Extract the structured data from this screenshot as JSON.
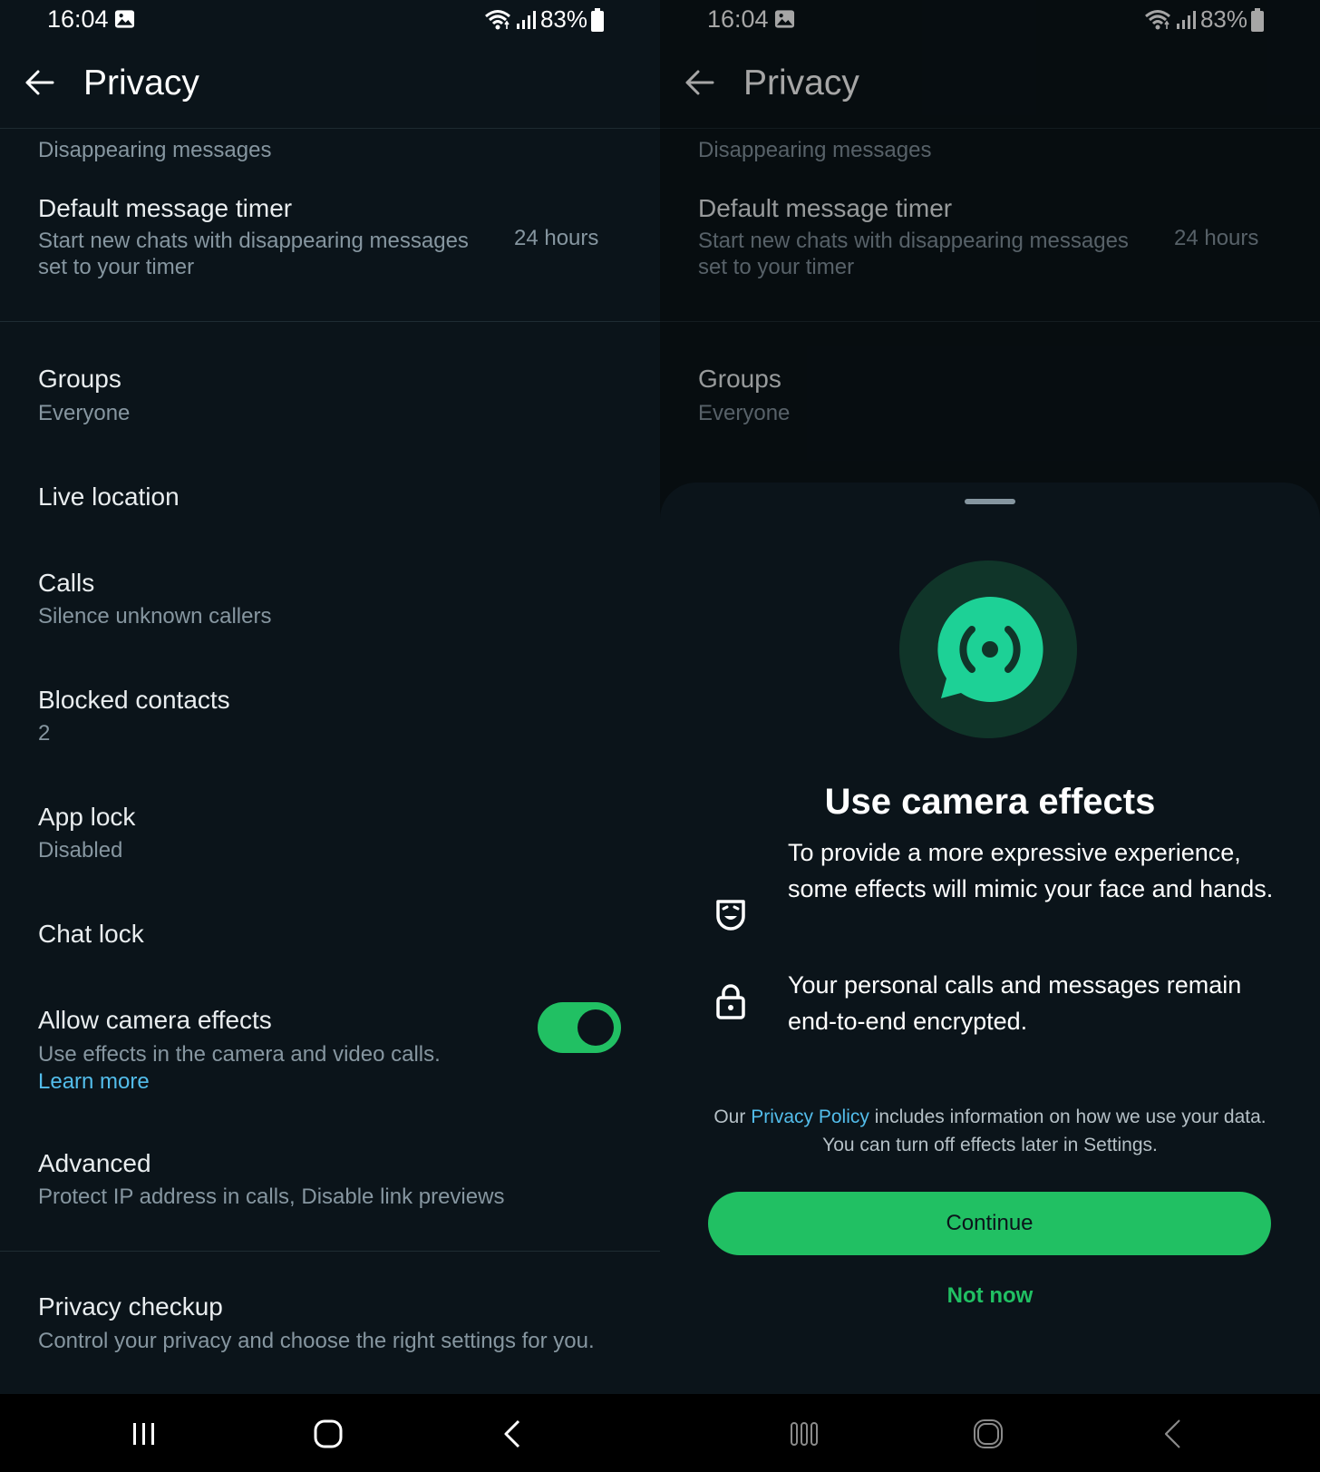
{
  "status_bar": {
    "time": "16:04",
    "battery": "83%"
  },
  "app_bar": {
    "title": "Privacy"
  },
  "privacy": {
    "section_disappearing": "Disappearing messages",
    "default_timer": {
      "title": "Default message timer",
      "subtitle": "Start new chats with disappearing messages set to your timer",
      "value": "24 hours"
    },
    "groups": {
      "title": "Groups",
      "value": "Everyone"
    },
    "live_location": {
      "title": "Live location"
    },
    "calls": {
      "title": "Calls",
      "value": "Silence unknown callers"
    },
    "blocked_contacts": {
      "title": "Blocked contacts",
      "value": "2"
    },
    "app_lock": {
      "title": "App lock",
      "value": "Disabled"
    },
    "chat_lock": {
      "title": "Chat lock"
    },
    "camera_effects": {
      "title": "Allow camera effects",
      "subtitle": "Use effects in the camera and video calls.",
      "link": "Learn more",
      "enabled": true
    },
    "advanced": {
      "title": "Advanced",
      "value": "Protect IP address in calls, Disable link previews"
    },
    "privacy_checkup": {
      "title": "Privacy checkup",
      "value": "Control your privacy and choose the right settings for you."
    }
  },
  "sheet": {
    "title": "Use camera effects",
    "feature_1": "To provide a more expressive experience, some effects will mimic your face and hands.",
    "feature_2": "Your personal calls and messages remain end-to-end encrypted.",
    "policy_prefix": "Our ",
    "policy_link": "Privacy Policy",
    "policy_suffix": " includes information on how we use your data.",
    "policy_line2": "You can turn off effects later in Settings.",
    "continue_label": "Continue",
    "not_now_label": "Not now"
  },
  "colors": {
    "background": "#0b141a",
    "accent_green": "#21c063",
    "link_blue": "#53bdeb",
    "secondary_text": "#8696a0",
    "icon_circle": "#103529",
    "icon_fill": "#1dd196"
  },
  "icons": [
    "gallery-icon",
    "wifi-icon",
    "signal-icon",
    "battery-icon",
    "back-arrow-icon",
    "recent-apps-icon",
    "home-icon",
    "nav-back-icon",
    "camera-effects-icon",
    "face-mask-icon",
    "lock-icon"
  ]
}
